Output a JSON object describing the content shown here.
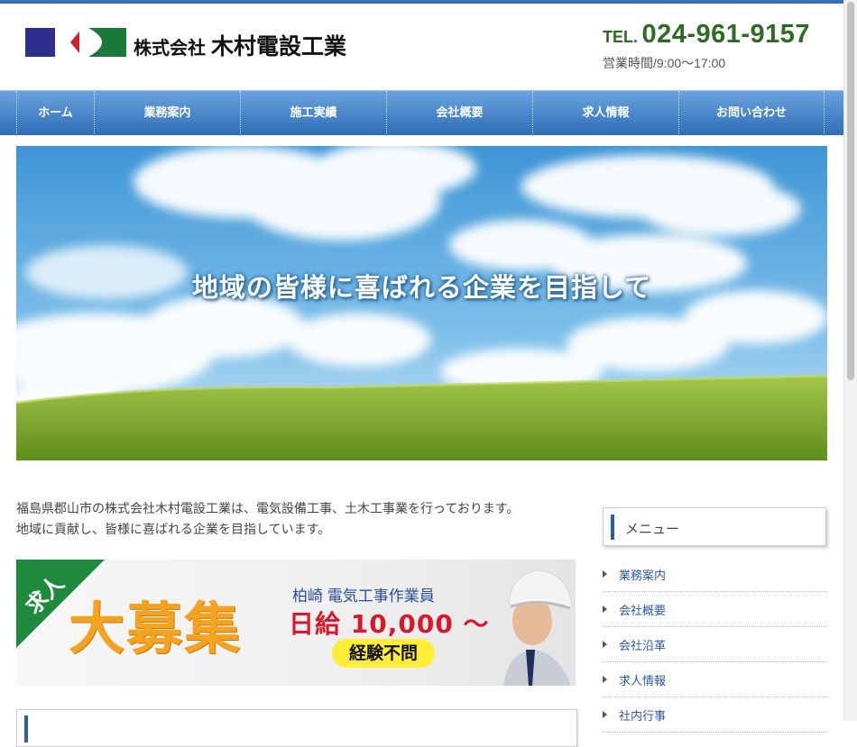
{
  "header": {
    "logo_small": "株式会社",
    "logo_big": "木村電設工業",
    "tel_prefix": "TEL.",
    "tel_number": "024-961-9157",
    "hours": "営業時間/9:00～17:00"
  },
  "nav": {
    "items": [
      {
        "label": "ホーム"
      },
      {
        "label": "業務案内"
      },
      {
        "label": "施工実績"
      },
      {
        "label": "会社概要"
      },
      {
        "label": "求人情報"
      },
      {
        "label": "お問い合わせ"
      }
    ]
  },
  "hero": {
    "headline": "地域の皆様に喜ばれる企業を目指して"
  },
  "intro": {
    "line1": "福島県郡山市の株式会社木村電設工業は、電気設備工事、土木工事業を行っております。",
    "line2": "地域に貢献し、皆様に喜ばれる企業を目指しています。"
  },
  "banner": {
    "corner": "求人",
    "main": "大募集",
    "sub": "柏崎 電気工事作業員",
    "wage": "日給 10,000 ～",
    "experience": "経験不問"
  },
  "sidebar": {
    "title": "メニュー",
    "items": [
      {
        "label": "業務案内"
      },
      {
        "label": "会社概要"
      },
      {
        "label": "会社沿革"
      },
      {
        "label": "求人情報"
      },
      {
        "label": "社内行事"
      }
    ]
  },
  "colors": {
    "accent": "#3b6fb6",
    "nav_top": "#6aa3de",
    "nav_bottom": "#2f6db6",
    "tel_green": "#2d6a22",
    "banner_green": "#1e8a3c",
    "banner_orange": "#f4a21f",
    "wage_red": "#d8192d"
  }
}
